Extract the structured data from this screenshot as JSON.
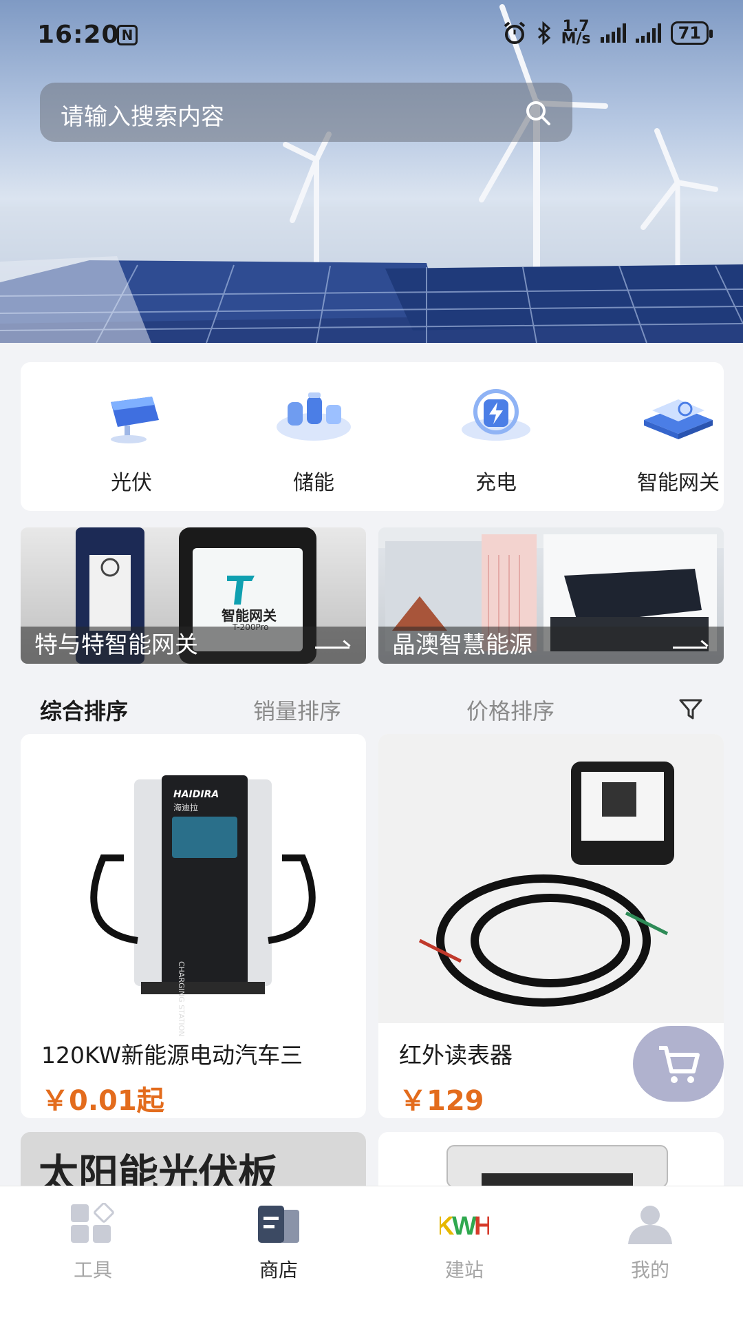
{
  "status_bar": {
    "time": "16:20",
    "nfc": "N",
    "speed_value": "1.7",
    "speed_unit": "M/s",
    "battery": "71"
  },
  "search": {
    "placeholder": "请输入搜索内容"
  },
  "categories": [
    {
      "label": "光伏",
      "icon": "solar-panel-icon"
    },
    {
      "label": "储能",
      "icon": "energy-storage-icon"
    },
    {
      "label": "充电",
      "icon": "charging-icon"
    },
    {
      "label": "智能网关",
      "icon": "smart-gateway-icon"
    }
  ],
  "banners": [
    {
      "caption": "特与特智能网关",
      "screen_title": "智能网关",
      "screen_model": "T-200Pro"
    },
    {
      "caption": "晶澳智慧能源"
    }
  ],
  "sort": {
    "comprehensive": "综合排序",
    "sales": "销量排序",
    "price": "价格排序"
  },
  "products": [
    {
      "name": "120KW新能源电动汽车三",
      "price": "￥0.01起",
      "brand": "HAIDIRA",
      "brand_cn": "海迪拉",
      "device_text": "CHARGING STATION"
    },
    {
      "name": "红外读表器",
      "price": "￥129"
    }
  ],
  "partial_products": [
    {
      "name_overlay": "太阳能光伏板"
    }
  ],
  "bottom_nav": [
    {
      "label": "工具",
      "icon": "tools-grid-icon",
      "active": false
    },
    {
      "label": "商店",
      "icon": "store-icon",
      "active": true
    },
    {
      "label": "建站",
      "icon": "kwh-logo-icon",
      "active": false
    },
    {
      "label": "我的",
      "icon": "profile-icon",
      "active": false
    }
  ],
  "colors": {
    "price": "#e36c1d",
    "nav_inactive": "#a6a6a6",
    "page_bg": "#f2f3f6"
  }
}
